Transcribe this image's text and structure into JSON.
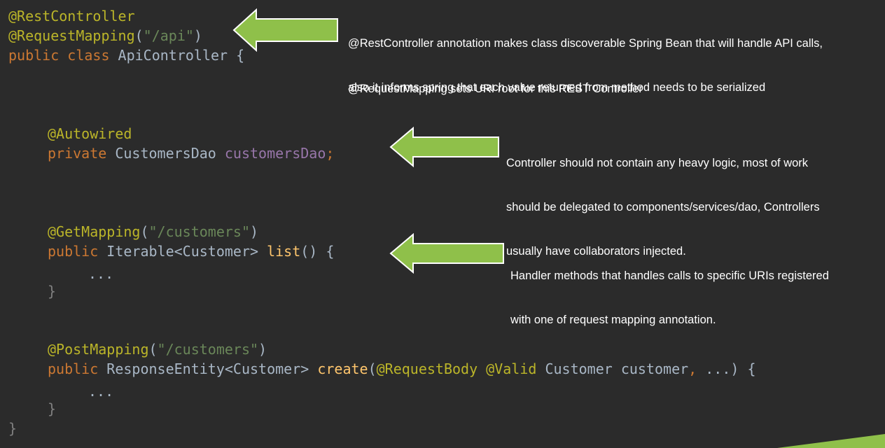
{
  "code": {
    "l1": {
      "ann": "@RestController"
    },
    "l2": {
      "ann": "@RequestMapping",
      "p1": "(",
      "str": "\"/api\"",
      "p2": ")"
    },
    "l3": {
      "kw": "public class ",
      "name": "ApiController {"
    },
    "l4": {
      "ann": "@Autowired"
    },
    "l5": {
      "kw": "private ",
      "type": "CustomersDao ",
      "field": "customersDao",
      "semi": ";"
    },
    "l6": {
      "ann": "@GetMapping",
      "p1": "(",
      "str": "\"/customers\"",
      "p2": ")"
    },
    "l7": {
      "kw": "public ",
      "type": "Iterable<Customer> ",
      "fn": "list",
      "rest": "() {"
    },
    "l8": {
      "dots": "..."
    },
    "l9": {
      "brace": "}"
    },
    "l10": {
      "ann": "@PostMapping",
      "p1": "(",
      "str": "\"/customers\"",
      "p2": ")"
    },
    "l11": {
      "kw": "public ",
      "type": "ResponseEntity<Customer> ",
      "fn": "create",
      "open": "(",
      "ann1": "@RequestBody ",
      "ann2": "@Valid ",
      "param": "Customer customer",
      "comma": ",",
      "rest": " ...) {"
    },
    "l12": {
      "dots": "..."
    },
    "l13": {
      "brace": "}"
    },
    "l14": {
      "brace": "}"
    }
  },
  "notes": {
    "rest_controller": {
      "line1": "@RestController annotation makes class discoverable Spring Bean that will handle API calls,",
      "line2": "also it informs spring that each value returned from method needs to be serialized"
    },
    "request_mapping": {
      "line1": "@RequestMapping sets URI root for this REST Controller"
    },
    "controller": {
      "line1": "Controller should not contain any heavy logic, most of work",
      "line2": "should be delegated to components/services/dao, Controllers",
      "line3": "usually have collaborators injected."
    },
    "handler": {
      "line1": "Handler methods that handles calls to specific URIs registered",
      "line2": "with one of request mapping annotation."
    }
  },
  "colors": {
    "background": "#2b2b2b",
    "annotation": "#bbb529",
    "keyword": "#cc7832",
    "string": "#6a8759",
    "field": "#9876aa",
    "function": "#ffc66d",
    "plain": "#a9b7c6",
    "arrow": "#8fc04a",
    "note_text": "#ffffff"
  }
}
